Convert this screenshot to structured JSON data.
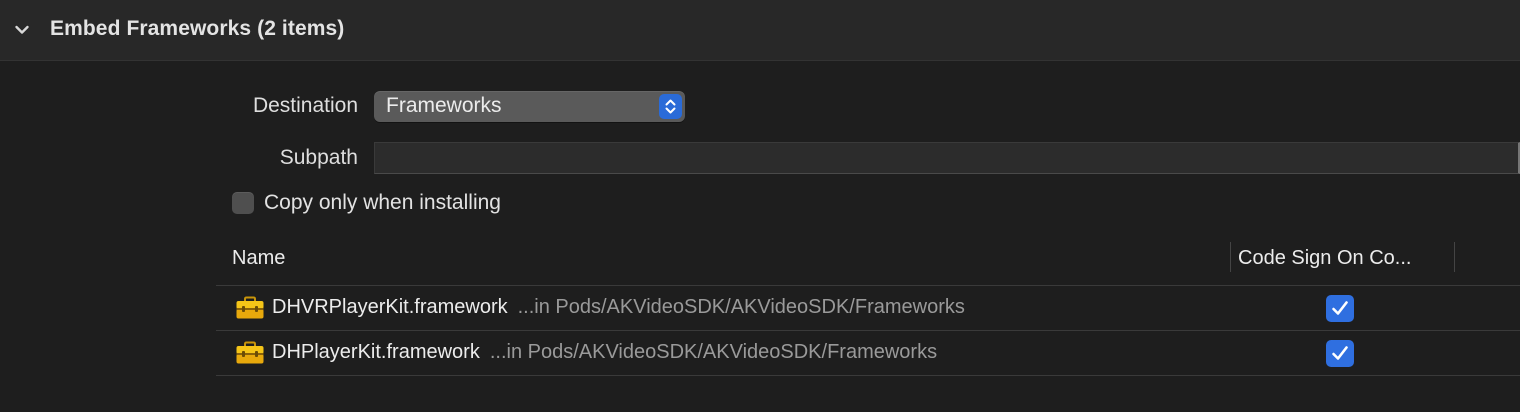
{
  "section": {
    "title": "Embed Frameworks (2 items)"
  },
  "destination": {
    "label": "Destination",
    "value": "Frameworks"
  },
  "subpath": {
    "label": "Subpath",
    "value": ""
  },
  "copy_only": {
    "label": "Copy only when installing",
    "checked": false
  },
  "table": {
    "columns": {
      "name": "Name",
      "code_sign": "Code Sign On Co..."
    },
    "rows": [
      {
        "name": "DHVRPlayerKit.framework",
        "path": "...in Pods/AKVideoSDK/AKVideoSDK/Frameworks",
        "code_sign": true,
        "icon": "toolbox-icon"
      },
      {
        "name": "DHPlayerKit.framework",
        "path": "...in Pods/AKVideoSDK/AKVideoSDK/Frameworks",
        "code_sign": true,
        "icon": "toolbox-icon"
      }
    ]
  },
  "colors": {
    "accent": "#2f6fe0",
    "icon_yellow": "#f5c518"
  }
}
